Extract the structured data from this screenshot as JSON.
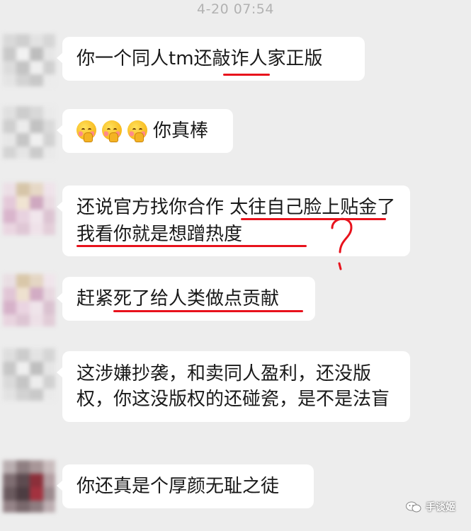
{
  "chat": {
    "timestamp": "4-20 07:54",
    "messages": [
      {
        "text": "你一个同人tm还敲诈人家正版"
      },
      {
        "emoji_count": 3,
        "emoji_name": "shy-emoji-icon",
        "text": "你真棒"
      },
      {
        "text": "还说官方找你合作 太往自己脸上贴金了 我看你就是想蹭热度"
      },
      {
        "text": "赶紧死了给人类做点贡献"
      },
      {
        "text": "这涉嫌抄袭，和卖同人盈利，还没版权，你这没版权的还碰瓷，是不是法盲"
      },
      {
        "text": "你还真是个厚颜无耻之徒"
      }
    ]
  },
  "annotations": {
    "color": "#e8121c",
    "question_mark_icon": "question-mark-icon"
  },
  "watermark": {
    "icon": "wechat-icon",
    "text": "手谈姬"
  }
}
